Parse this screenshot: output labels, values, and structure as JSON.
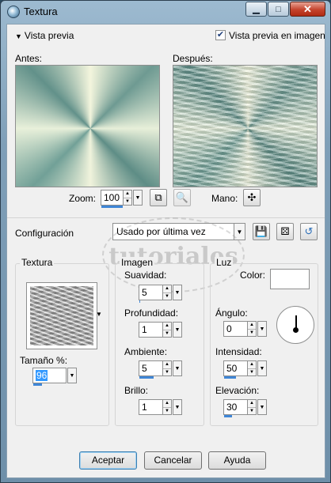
{
  "window": {
    "title": "Textura"
  },
  "preview": {
    "toggle_label": "Vista previa",
    "checkbox_label": "Vista previa en imagen",
    "checkbox_checked": true,
    "before_label": "Antes:",
    "after_label": "Después:"
  },
  "zoom": {
    "label": "Zoom:",
    "value": "100",
    "hand_label": "Mano:"
  },
  "config": {
    "label": "Configuración",
    "preset": "Usado por última vez"
  },
  "watermark": "tutoriales",
  "texture_group": {
    "title": "Textura",
    "size_label": "Tamaño %:",
    "size_value": "96"
  },
  "image_group": {
    "title": "Imagen",
    "smoothness_label": "Suavidad:",
    "smoothness_value": "5",
    "depth_label": "Profundidad:",
    "depth_value": "1",
    "ambient_label": "Ambiente:",
    "ambient_value": "5",
    "shine_label": "Brillo:",
    "shine_value": "1"
  },
  "light_group": {
    "title": "Luz",
    "color_label": "Color:",
    "color_value": "#ffffff",
    "angle_label": "Ángulo:",
    "angle_value": "0",
    "intensity_label": "Intensidad:",
    "intensity_value": "50",
    "elevation_label": "Elevación:",
    "elevation_value": "30"
  },
  "buttons": {
    "ok": "Aceptar",
    "cancel": "Cancelar",
    "help": "Ayuda"
  },
  "colors": {
    "accent": "#3f86d6",
    "selection": "#3399ff"
  }
}
